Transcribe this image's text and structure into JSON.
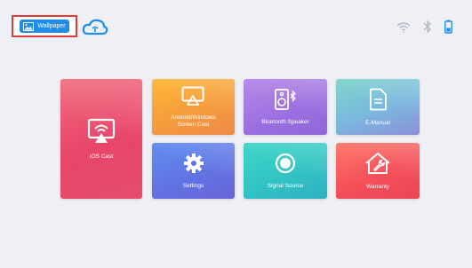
{
  "topbar": {
    "wallpaper_label": "Wallpaper",
    "wallpaper_icon": "image-icon",
    "cloud_icon": "cloud-icon",
    "status_icons": [
      "wifi-icon",
      "bluetooth-icon",
      "battery-icon"
    ]
  },
  "tiles": [
    {
      "label": "IOS Cast",
      "icon": "airplay-icon",
      "color": "#e8456a"
    },
    {
      "label": "Android/Windows\nScreen Cast",
      "icon": "screen-cast-icon",
      "color": "#f59c3b"
    },
    {
      "label": "Bluetooth Speaker",
      "icon": "speaker-icon",
      "color": "#9b6fe0"
    },
    {
      "label": "E-Manual",
      "icon": "document-icon",
      "color": "#7bb7df"
    },
    {
      "label": "Settings",
      "icon": "gear-icon",
      "color": "#6274e4"
    },
    {
      "label": "Signal Source",
      "icon": "circle-icon",
      "color": "#33c3c4"
    },
    {
      "label": "Warranty",
      "icon": "house-wrench-icon",
      "color": "#f4515a"
    }
  ],
  "colors": {
    "background": "#eef0f5",
    "accent": "#1f8ee8",
    "highlight_border": "#e03b3b"
  }
}
